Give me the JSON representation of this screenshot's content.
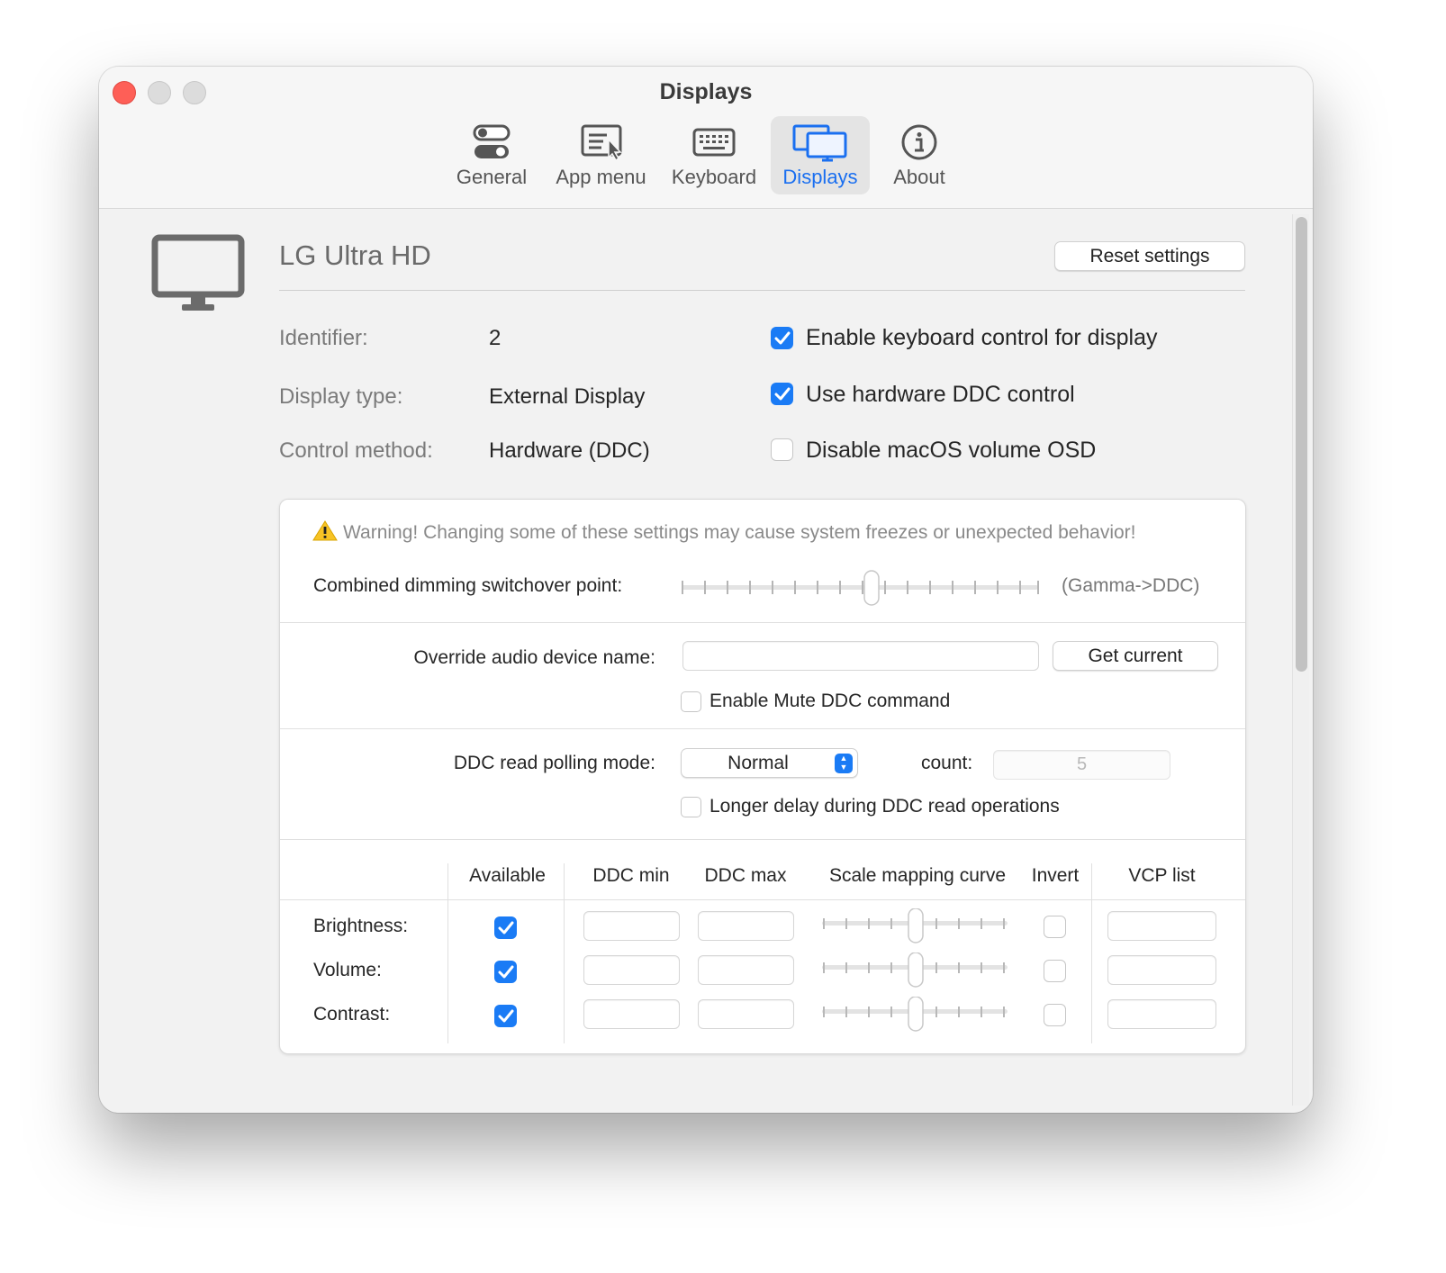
{
  "window": {
    "title": "Displays"
  },
  "tabs": [
    {
      "label": "General",
      "icon": "toggles-icon"
    },
    {
      "label": "App menu",
      "icon": "app-menu-icon"
    },
    {
      "label": "Keyboard",
      "icon": "keyboard-icon"
    },
    {
      "label": "Displays",
      "icon": "displays-icon",
      "active": true
    },
    {
      "label": "About",
      "icon": "info-icon"
    }
  ],
  "display": {
    "name": "LG Ultra HD",
    "reset_label": "Reset settings",
    "identifier_label": "Identifier:",
    "identifier_value": "2",
    "type_label": "Display type:",
    "type_value": "External Display",
    "method_label": "Control method:",
    "method_value": "Hardware (DDC)",
    "options": [
      {
        "label": "Enable keyboard control for display",
        "checked": true
      },
      {
        "label": "Use hardware DDC control",
        "checked": true
      },
      {
        "label": "Disable macOS volume OSD",
        "checked": false
      }
    ]
  },
  "advanced": {
    "warning": "Warning! Changing some of these settings may cause system freezes or unexpected behavior!",
    "switchover_label": "Combined dimming switchover point:",
    "switchover_suffix": "(Gamma->DDC)",
    "switchover_value": 0.53,
    "audio_label": "Override audio device name:",
    "audio_value": "",
    "get_current_label": "Get current",
    "mute_label": "Enable Mute DDC command",
    "mute_checked": false,
    "polling_label": "DDC read polling mode:",
    "polling_value": "Normal",
    "count_label": "count:",
    "count_value": "5",
    "delay_label": "Longer delay during DDC read operations",
    "delay_checked": false
  },
  "table": {
    "headers": [
      "Available",
      "DDC min",
      "DDC max",
      "Scale mapping curve",
      "Invert",
      "VCP list"
    ],
    "rows": [
      {
        "label": "Brightness:",
        "available": true,
        "invert": false,
        "curve": 0.5
      },
      {
        "label": "Volume:",
        "available": true,
        "invert": false,
        "curve": 0.5
      },
      {
        "label": "Contrast:",
        "available": true,
        "invert": false,
        "curve": 0.5
      }
    ]
  },
  "colors": {
    "accent": "#1a7bf5",
    "close": "#fe5f57"
  }
}
